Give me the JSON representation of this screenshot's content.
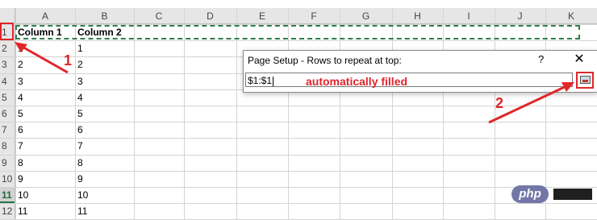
{
  "spreadsheet": {
    "columns": [
      "A",
      "B",
      "C",
      "D",
      "E",
      "F",
      "G",
      "H",
      "I",
      "J",
      "K"
    ],
    "rows": [
      "1",
      "2",
      "3",
      "4",
      "5",
      "6",
      "7",
      "8",
      "9",
      "10",
      "11",
      "12"
    ],
    "selected_row": "11",
    "cells_a": [
      "Column 1",
      "1",
      "2",
      "3",
      "4",
      "5",
      "6",
      "7",
      "8",
      "9",
      "10",
      "11"
    ],
    "cells_b": [
      "Column 2",
      "1",
      "2",
      "3",
      "4",
      "5",
      "6",
      "7",
      "8",
      "9",
      "10",
      "11"
    ]
  },
  "dialog": {
    "title": "Page Setup - Rows to repeat at top:",
    "help": "?",
    "close": "✕",
    "input_value": "$1:$1"
  },
  "annotations": {
    "filled_text": "automatically filled",
    "step1": "1",
    "step2": "2",
    "accent_color": "#e0262a"
  },
  "watermark": {
    "text": "php"
  }
}
